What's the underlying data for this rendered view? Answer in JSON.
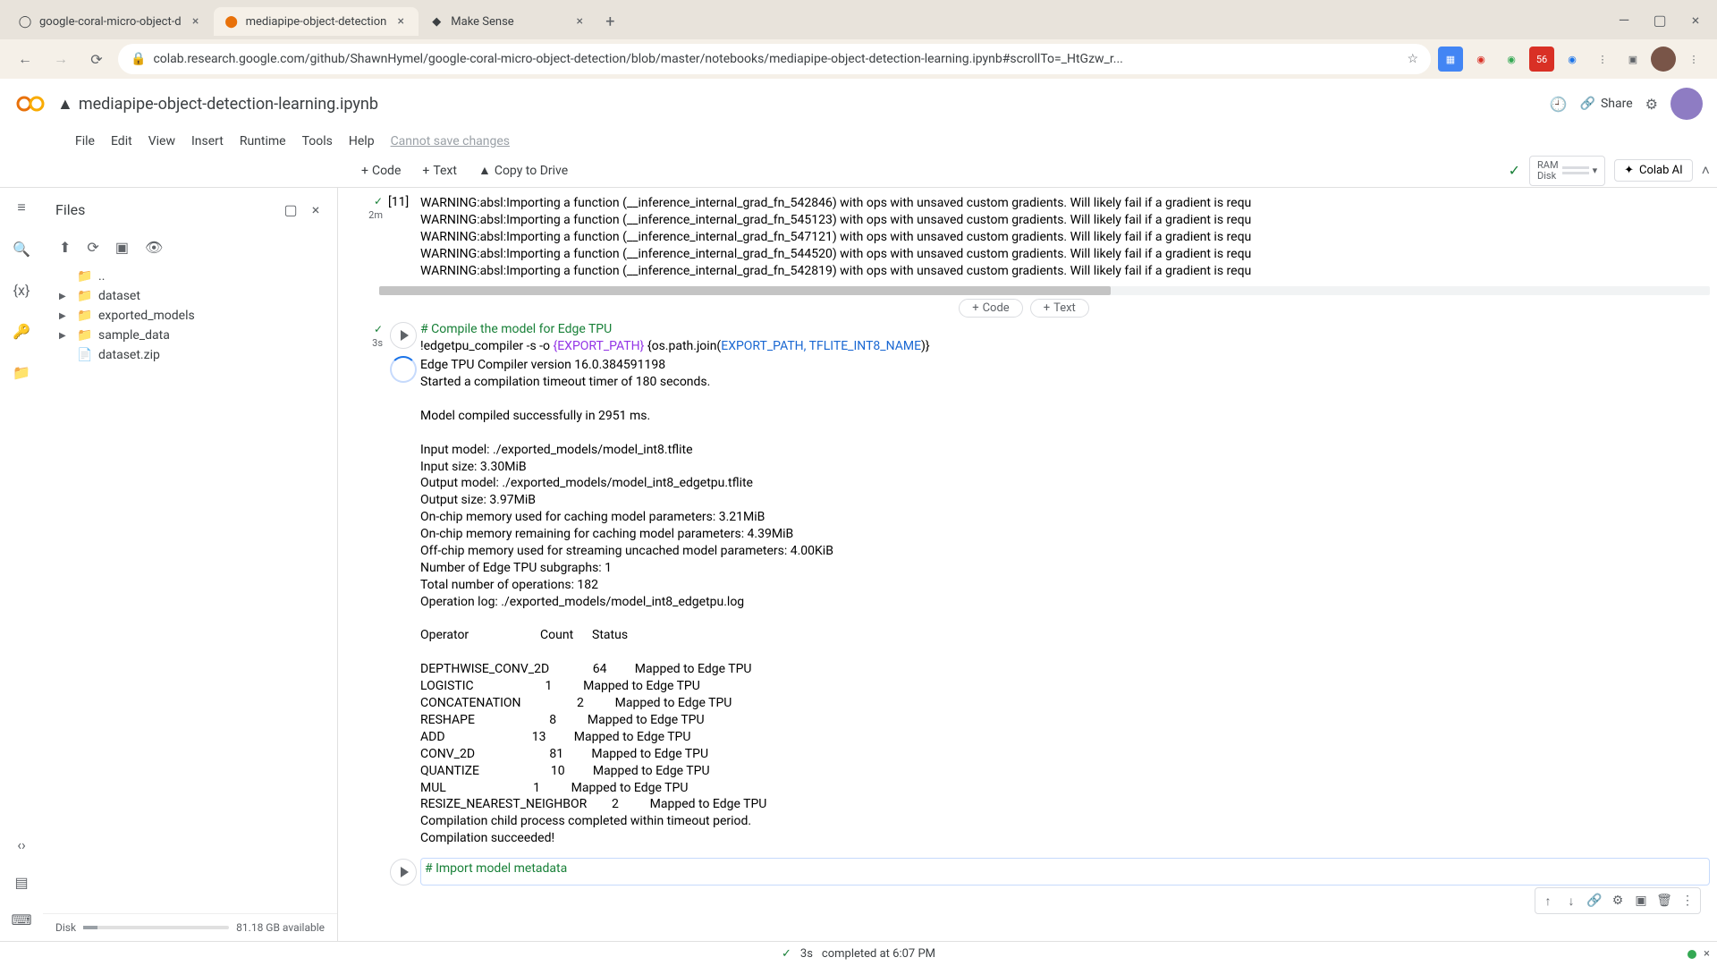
{
  "browser": {
    "tabs": [
      {
        "title": "google-coral-micro-object-d"
      },
      {
        "title": "mediapipe-object-detection"
      },
      {
        "title": "Make Sense"
      }
    ],
    "url": "colab.research.google.com/github/ShawnHymel/google-coral-micro-object-detection/blob/master/notebooks/mediapipe-object-detection-learning.ipynb#scrollTo=_HtGzw_r..."
  },
  "header": {
    "title": "mediapipe-object-detection-learning.ipynb",
    "share": "Share"
  },
  "menu": {
    "file": "File",
    "edit": "Edit",
    "view": "View",
    "insert": "Insert",
    "runtime": "Runtime",
    "tools": "Tools",
    "help": "Help",
    "nosave": "Cannot save changes"
  },
  "toolbar": {
    "code": "Code",
    "text": "Text",
    "copy": "Copy to Drive",
    "ram": "RAM",
    "disk": "Disk",
    "ai": "Colab AI"
  },
  "files": {
    "title": "Files",
    "parent": "..",
    "items": [
      "dataset",
      "exported_models",
      "sample_data",
      "dataset.zip"
    ],
    "footer_label": "Disk",
    "footer_avail": "81.18 GB available"
  },
  "insert": {
    "code": "Code",
    "text": "Text"
  },
  "cell1": {
    "num": "[11]",
    "time": "2m",
    "out": "WARNING:absl:Importing a function (__inference_internal_grad_fn_542846) with ops with unsaved custom gradients. Will likely fail if a gradient is requ\nWARNING:absl:Importing a function (__inference_internal_grad_fn_545123) with ops with unsaved custom gradients. Will likely fail if a gradient is requ\nWARNING:absl:Importing a function (__inference_internal_grad_fn_547121) with ops with unsaved custom gradients. Will likely fail if a gradient is requ\nWARNING:absl:Importing a function (__inference_internal_grad_fn_544520) with ops with unsaved custom gradients. Will likely fail if a gradient is requ\nWARNING:absl:Importing a function (__inference_internal_grad_fn_542819) with ops with unsaved custom gradients. Will likely fail if a gradient is requ"
  },
  "cell2": {
    "time": "3s",
    "comment": "# Compile the model for Edge TPU",
    "c1": "!edgetpu_compiler -s -o ",
    "c2": "{EXPORT_PATH}",
    "c3": " {os.path.join(",
    "c4": "EXPORT_PATH, TFLITE_INT8_NAME",
    "c5": ")}",
    "out": "Edge TPU Compiler version 16.0.384591198\nStarted a compilation timeout timer of 180 seconds.\n\nModel compiled successfully in 2951 ms.\n\nInput model: ./exported_models/model_int8.tflite\nInput size: 3.30MiB\nOutput model: ./exported_models/model_int8_edgetpu.tflite\nOutput size: 3.97MiB\nOn-chip memory used for caching model parameters: 3.21MiB\nOn-chip memory remaining for caching model parameters: 4.39MiB\nOff-chip memory used for streaming uncached model parameters: 4.00KiB\nNumber of Edge TPU subgraphs: 1\nTotal number of operations: 182\nOperation log: ./exported_models/model_int8_edgetpu.log\n\nOperator                       Count      Status\n\nDEPTHWISE_CONV_2D              64         Mapped to Edge TPU\nLOGISTIC                       1          Mapped to Edge TPU\nCONCATENATION                  2          Mapped to Edge TPU\nRESHAPE                        8          Mapped to Edge TPU\nADD                            13         Mapped to Edge TPU\nCONV_2D                        81         Mapped to Edge TPU\nQUANTIZE                       10         Mapped to Edge TPU\nMUL                            1          Mapped to Edge TPU\nRESIZE_NEAREST_NEIGHBOR        2          Mapped to Edge TPU\nCompilation child process completed within timeout period.\nCompilation succeeded!"
  },
  "cell3": {
    "comment": "# Import model metadata"
  },
  "status": {
    "dur": "3s",
    "msg": "completed at 6:07 PM"
  }
}
